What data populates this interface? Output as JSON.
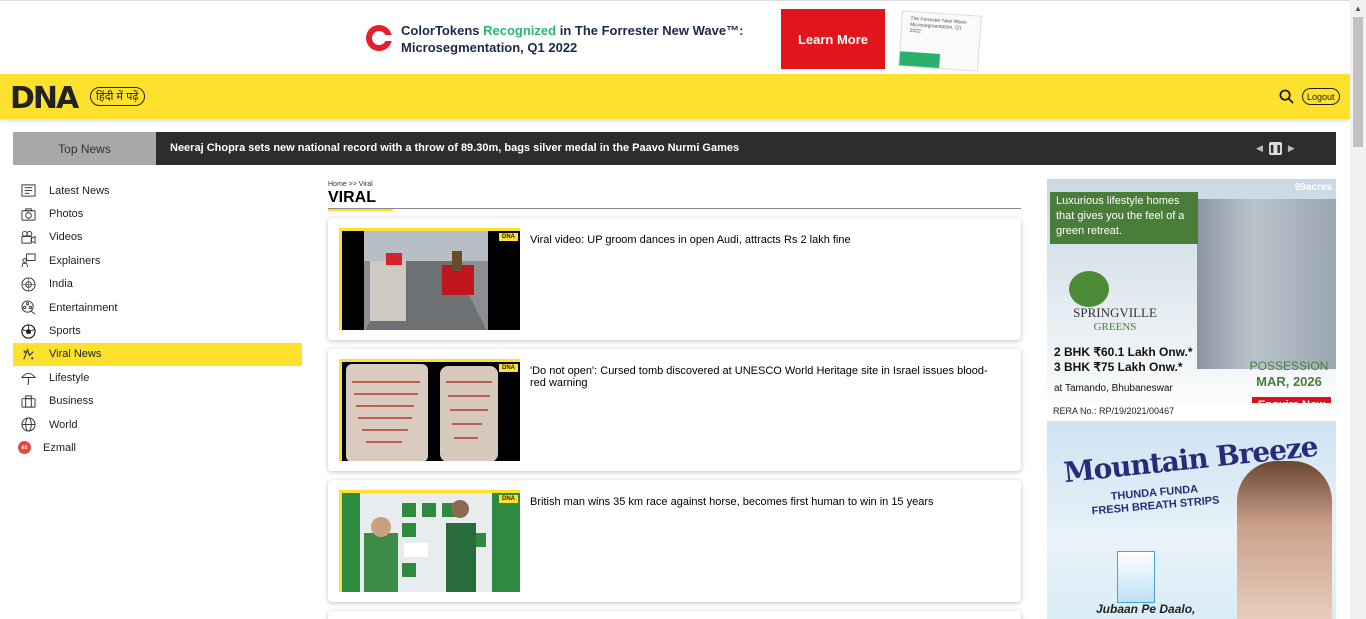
{
  "top_ad": {
    "headline_part1": "ColorTokens",
    "headline_highlight": "Recognized",
    "headline_part2": "in The Forrester New Wave™:",
    "headline_line2": "Microsegmentation, Q1 2022",
    "cta": "Learn More",
    "report_text": "The Forrester New Wave: Microsegmentation, Q1 2022"
  },
  "header": {
    "logo": "DNA",
    "hindi_button": "हिंदी में पढ़ें",
    "logout": "Logout"
  },
  "ticker": {
    "label": "Top News",
    "headline": "Neeraj Chopra sets new national record with a throw of 89.30m, bags silver medal in the Paavo Nurmi Games",
    "prev_icon": "prev-icon",
    "pause_icon": "pause-icon",
    "next_icon": "next-icon"
  },
  "sidebar": {
    "items": [
      {
        "label": "Latest News",
        "icon": "newspaper-icon"
      },
      {
        "label": "Photos",
        "icon": "camera-icon"
      },
      {
        "label": "Videos",
        "icon": "video-camera-icon"
      },
      {
        "label": "Explainers",
        "icon": "explainer-icon"
      },
      {
        "label": "India",
        "icon": "india-icon"
      },
      {
        "label": "Entertainment",
        "icon": "film-reel-icon"
      },
      {
        "label": "Sports",
        "icon": "football-icon"
      },
      {
        "label": "Viral News",
        "icon": "viral-icon"
      },
      {
        "label": "Lifestyle",
        "icon": "umbrella-icon"
      },
      {
        "label": "Business",
        "icon": "briefcase-icon"
      },
      {
        "label": "World",
        "icon": "globe-icon"
      },
      {
        "label": "Ezmall",
        "icon": "ezmall-icon"
      }
    ],
    "active": "Viral News"
  },
  "main": {
    "breadcrumb_home": "Home",
    "breadcrumb_sep": ">>",
    "breadcrumb_current": "Viral",
    "section_title": "VIRAL",
    "articles": [
      {
        "title": "Viral video: UP groom dances in open Audi, attracts Rs 2 lakh fine",
        "tag": "DNA"
      },
      {
        "title": "'Do not open': Cursed tomb discovered at UNESCO World Heritage site in Israel issues blood-red warning",
        "tag": "DNA"
      },
      {
        "title": "British man wins 35 km race against horse, becomes first human to win in 15 years",
        "tag": "DNA"
      }
    ]
  },
  "ad_right_1": {
    "brand": "99acres",
    "tagline": "Luxurious lifestyle homes that gives you the feel of a green retreat.",
    "project": "SPRINGVILLE",
    "project_sub": "GREENS",
    "price_line1": "2 BHK ₹60.1 Lakh Onw.*",
    "price_line2": "3 BHK ₹75 Lakh Onw.*",
    "location": "at Tamando, Bhubaneswar",
    "possession_label": "POSSESSION",
    "possession_date": "MAR, 2026",
    "cta": "Enquire Now",
    "rera": "RERA No.: RP/19/2021/00467"
  },
  "ad_right_2": {
    "title": "Mountain Breeze",
    "sub1": "THUNDA FUNDA",
    "sub2": "FRESH BREATH STRIPS",
    "footer": "Jubaan Pe Daalo,"
  }
}
